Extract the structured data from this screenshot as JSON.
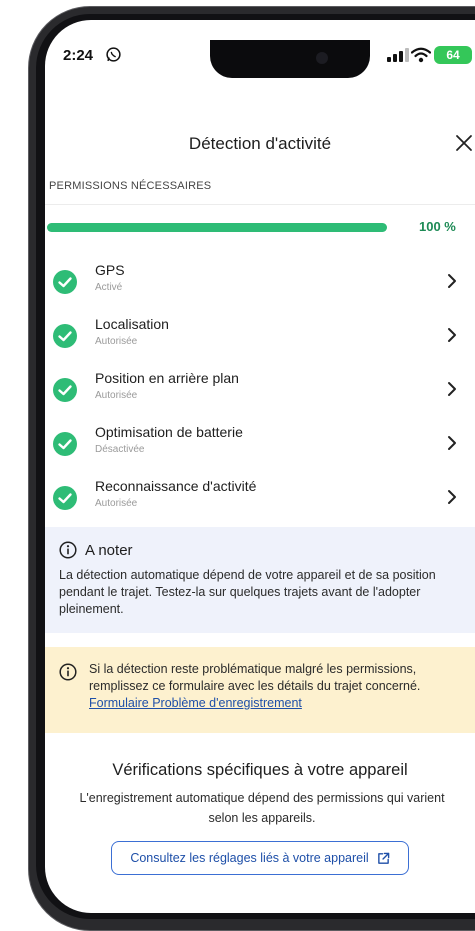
{
  "status_bar": {
    "time": "2:24",
    "battery": "64"
  },
  "header": {
    "title": "Détection d'activité"
  },
  "permissions": {
    "section_label": "PERMISSIONS NÉCESSAIRES",
    "progress_percent": 100,
    "progress_text": "100 %",
    "items": [
      {
        "name": "GPS",
        "status": "Activé"
      },
      {
        "name": "Localisation",
        "status": "Autorisée"
      },
      {
        "name": "Position en arrière plan",
        "status": "Autorisée"
      },
      {
        "name": "Optimisation de batterie",
        "status": "Désactivée"
      },
      {
        "name": "Reconnaissance d'activité",
        "status": "Autorisée"
      }
    ]
  },
  "note": {
    "title": "A noter",
    "body": "La détection automatique dépend de votre appareil et de sa position pendant le trajet. Testez-la sur quelques trajets avant de l'adopter pleinement."
  },
  "warning": {
    "body": "Si la détection reste problématique malgré les permissions, remplissez ce formulaire avec les détails du trajet concerné.",
    "link": "Formulaire Problème d'enregistrement"
  },
  "device": {
    "title": "Vérifications spécifiques à votre appareil",
    "description": "L'enregistrement automatique dépend des permissions qui varient selon les appareils.",
    "button": "Consultez les réglages liés à votre appareil"
  },
  "colors": {
    "accent_green": "#2ebc76",
    "link_blue": "#1e4fa8",
    "note_bg": "#eff2fb",
    "warning_bg": "#fdf1cf"
  }
}
